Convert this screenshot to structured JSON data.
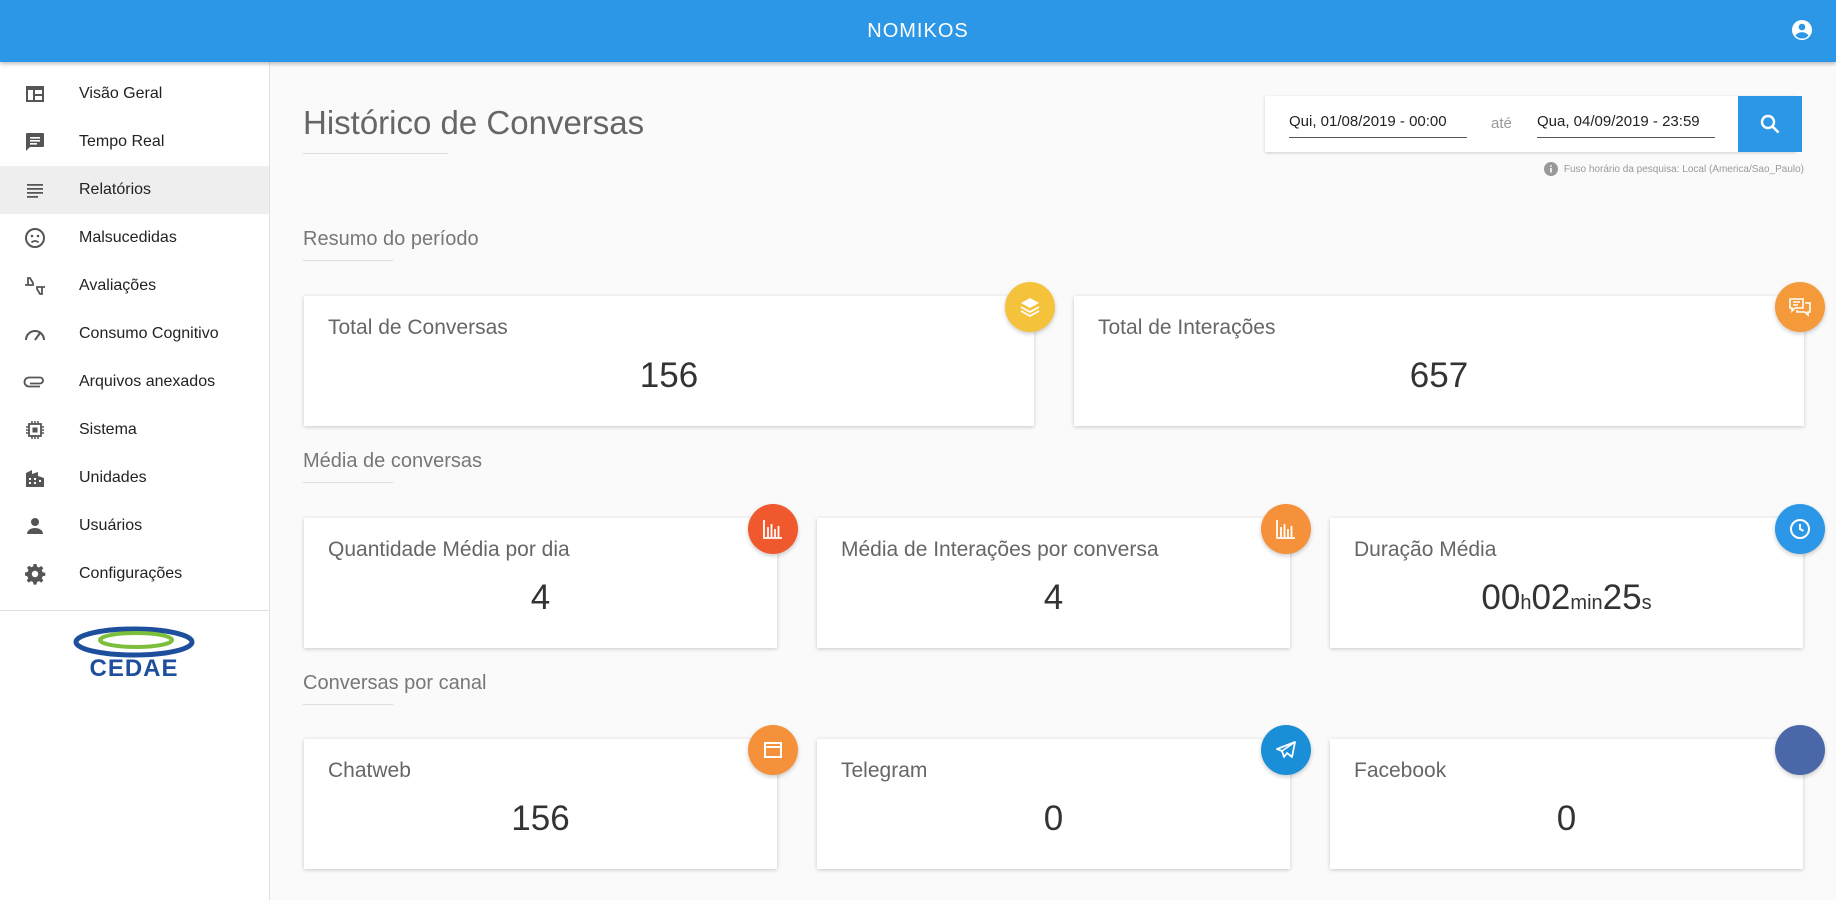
{
  "header": {
    "title": "NOMIKOS",
    "account_icon": "account-circle-icon"
  },
  "sidebar": {
    "items": [
      {
        "label": "Visão Geral",
        "icon": "dashboard-icon",
        "active": false
      },
      {
        "label": "Tempo Real",
        "icon": "chat-icon",
        "active": false
      },
      {
        "label": "Relatórios",
        "icon": "list-icon",
        "active": true
      },
      {
        "label": "Malsucedidas",
        "icon": "sad-face-icon",
        "active": false
      },
      {
        "label": "Avaliações",
        "icon": "thumbs-icon",
        "active": false
      },
      {
        "label": "Consumo Cognitivo",
        "icon": "speedometer-icon",
        "active": false
      },
      {
        "label": "Arquivos anexados",
        "icon": "attachment-icon",
        "active": false
      },
      {
        "label": "Sistema",
        "icon": "chip-icon",
        "active": false
      },
      {
        "label": "Unidades",
        "icon": "building-icon",
        "active": false
      },
      {
        "label": "Usuários",
        "icon": "person-icon",
        "active": false
      },
      {
        "label": "Configurações",
        "icon": "gear-icon",
        "active": false
      }
    ],
    "logo_text": "CEDAE"
  },
  "main": {
    "page_title": "Histórico de Conversas",
    "date_range": {
      "start": "Qui, 01/08/2019 - 00:00",
      "separator": "até",
      "end": "Qua, 04/09/2019 - 23:59",
      "timezone_note": "Fuso horário da pesquisa: Local (America/Sao_Paulo)"
    },
    "sections": {
      "summary": {
        "title": "Resumo do período",
        "cards": [
          {
            "label": "Total de Conversas",
            "value": "156",
            "icon": "layers-icon",
            "color": "#f5c23b"
          },
          {
            "label": "Total de Interações",
            "value": "657",
            "icon": "chat-bubbles-icon",
            "color": "#f59a3b"
          }
        ]
      },
      "averages": {
        "title": "Média de conversas",
        "cards": [
          {
            "label": "Quantidade Média por dia",
            "value": "4",
            "icon": "bar-chart-icon",
            "color": "#f0582e"
          },
          {
            "label": "Média de Interações por conversa",
            "value": "4",
            "icon": "bar-chart-icon",
            "color": "#f5913b"
          },
          {
            "label": "Duração Média",
            "duration": {
              "h": "00",
              "h_unit": "h",
              "min": "02",
              "min_unit": "min",
              "s": "25",
              "s_unit": "s"
            },
            "icon": "clock-icon",
            "color": "#2b97e6"
          }
        ]
      },
      "channels": {
        "title": "Conversas por canal",
        "cards": [
          {
            "label": "Chatweb",
            "value": "156",
            "icon": "window-icon",
            "color": "#f5913b"
          },
          {
            "label": "Telegram",
            "value": "0",
            "icon": "telegram-icon",
            "color": "#1a8fd8"
          },
          {
            "label": "Facebook",
            "value": "0",
            "icon": "facebook-icon",
            "color": "#4a67a8"
          }
        ]
      }
    }
  }
}
